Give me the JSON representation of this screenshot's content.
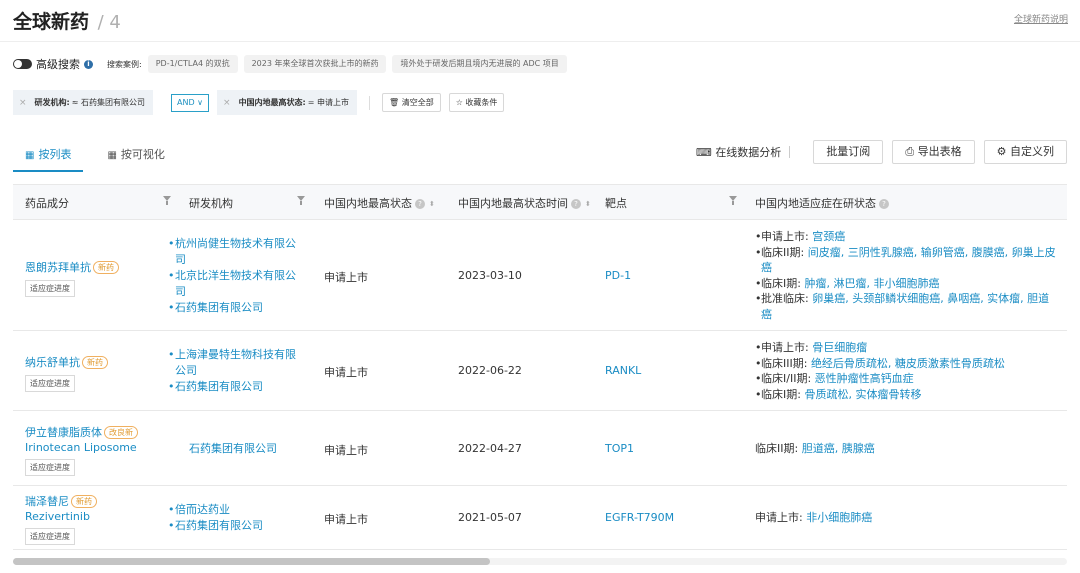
{
  "header": {
    "title": "全球新药",
    "count": "/ 4",
    "help_link": "全球新药说明"
  },
  "search": {
    "advanced_label": "高级搜索",
    "info_icon": "i",
    "examples_label": "搜索案例:",
    "examples": [
      "PD-1/CTLA4 的双抗",
      "2023 年来全球首次获批上市的新药",
      "境外处于研发后期且境内无进展的 ADC 项目"
    ]
  },
  "filters": {
    "tag1": {
      "x": "×",
      "key": "研发机构:",
      "value": "≈ 石药集团有限公司"
    },
    "operator": "AND ∨",
    "tag2": {
      "x": "×",
      "key": "中国内地最高状态:",
      "value": "= 申请上市"
    },
    "clear_all": "🗑 清空全部",
    "save": "☆ 收藏条件"
  },
  "tabs": {
    "list": {
      "icon": "▦",
      "label": "按列表"
    },
    "visual": {
      "icon": "▦",
      "label": "按可视化"
    }
  },
  "toolbar": {
    "analysis": "在线数据分析",
    "analysis_icon": "⌨",
    "subscribe": "批量订阅",
    "export": "导出表格",
    "export_icon": "⎙",
    "custom": "自定义列",
    "custom_icon": "⚙"
  },
  "table": {
    "headers": {
      "drug": "药品成分",
      "org": "研发机构",
      "status": "中国内地最高状态",
      "time": "中国内地最高状态时间",
      "target": "靶点",
      "indication": "中国内地适应症在研状态"
    },
    "q_mark": "?",
    "sort_icon": "⬍",
    "progress_label": "适应症进度",
    "rows": [
      {
        "name": "恩朗苏拜单抗",
        "en": "",
        "badge": "新药",
        "orgs": [
          "杭州尚健生物技术有限公司",
          "北京比洋生物技术有限公司",
          "石药集团有限公司"
        ],
        "status": "申请上市",
        "date": "2023-03-10",
        "target": "PD-1",
        "indications": [
          {
            "phase": "申请上市: ",
            "values": "宫颈癌"
          },
          {
            "phase": "临床II期: ",
            "values": "间皮瘤, 三阴性乳腺癌, 输卵管癌, 腹膜癌, 卵巢上皮癌"
          },
          {
            "phase": "临床I期: ",
            "values": "肿瘤, 淋巴瘤, 非小细胞肺癌"
          },
          {
            "phase": "批准临床: ",
            "values": "卵巢癌, 头颈部鳞状细胞癌, 鼻咽癌, 实体瘤, 胆道癌"
          }
        ]
      },
      {
        "name": "纳乐舒单抗",
        "en": "",
        "badge": "新药",
        "orgs": [
          "上海津曼特生物科技有限公司",
          "石药集团有限公司"
        ],
        "status": "申请上市",
        "date": "2022-06-22",
        "target": "RANKL",
        "indications": [
          {
            "phase": "申请上市: ",
            "values": "骨巨细胞瘤"
          },
          {
            "phase": "临床III期: ",
            "values": "绝经后骨质疏松, 糖皮质激素性骨质疏松"
          },
          {
            "phase": "临床I/II期: ",
            "values": "恶性肿瘤性高钙血症"
          },
          {
            "phase": "临床I期: ",
            "values": "骨质疏松, 实体瘤骨转移"
          }
        ]
      },
      {
        "name": "伊立替康脂质体",
        "en": "Irinotecan Liposome",
        "badge": "改良新",
        "orgs": [
          "石药集团有限公司"
        ],
        "status": "申请上市",
        "date": "2022-04-27",
        "target": "TOP1",
        "indications": [
          {
            "phase": "临床II期: ",
            "values": "胆道癌, 胰腺癌"
          }
        ]
      },
      {
        "name": "瑞泽替尼",
        "en": "Rezivertinib",
        "badge": "新药",
        "orgs": [
          "倍而达药业",
          "石药集团有限公司"
        ],
        "status": "申请上市",
        "date": "2021-05-07",
        "target": "EGFR-T790M",
        "indications": [
          {
            "phase": "申请上市: ",
            "values": "非小细胞肺癌"
          }
        ]
      }
    ]
  }
}
